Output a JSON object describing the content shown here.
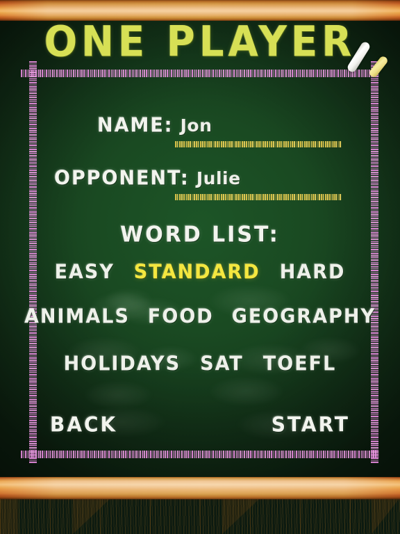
{
  "screen": {
    "title": "ONE PLAYER",
    "theme": {
      "board_green": "#1a4a22",
      "board_edge_green": "#0e2512",
      "title_chalk": "#d7e055",
      "chalk_white": "#f2f4ee",
      "chalk_yellow_selected": "#f4e73f",
      "underline_yellow": "#dfc44a",
      "border_pink": "#e88ce0",
      "wood_frame": "#f3c894",
      "wood_floor": "#e8b95c"
    }
  },
  "fields": [
    {
      "label": "NAME:",
      "value": "Jon"
    },
    {
      "label": "OPPONENT:",
      "value": "Julie"
    }
  ],
  "word_list": {
    "heading": "WORD LIST:",
    "selected": "STANDARD",
    "rows": [
      [
        {
          "label": "EASY",
          "selected": false
        },
        {
          "label": "STANDARD",
          "selected": true
        },
        {
          "label": "HARD",
          "selected": false
        }
      ],
      [
        {
          "label": "ANIMALS",
          "selected": false
        },
        {
          "label": "FOOD",
          "selected": false
        },
        {
          "label": "GEOGRAPHY",
          "selected": false
        }
      ],
      [
        {
          "label": "HOLIDAYS",
          "selected": false
        },
        {
          "label": "SAT",
          "selected": false
        },
        {
          "label": "TOEFL",
          "selected": false
        }
      ]
    ]
  },
  "buttons": {
    "back": "BACK",
    "start": "START"
  },
  "decor": {
    "chalk_white": "white-chalk-stick",
    "chalk_yellow": "yellow-chalk-stick"
  }
}
